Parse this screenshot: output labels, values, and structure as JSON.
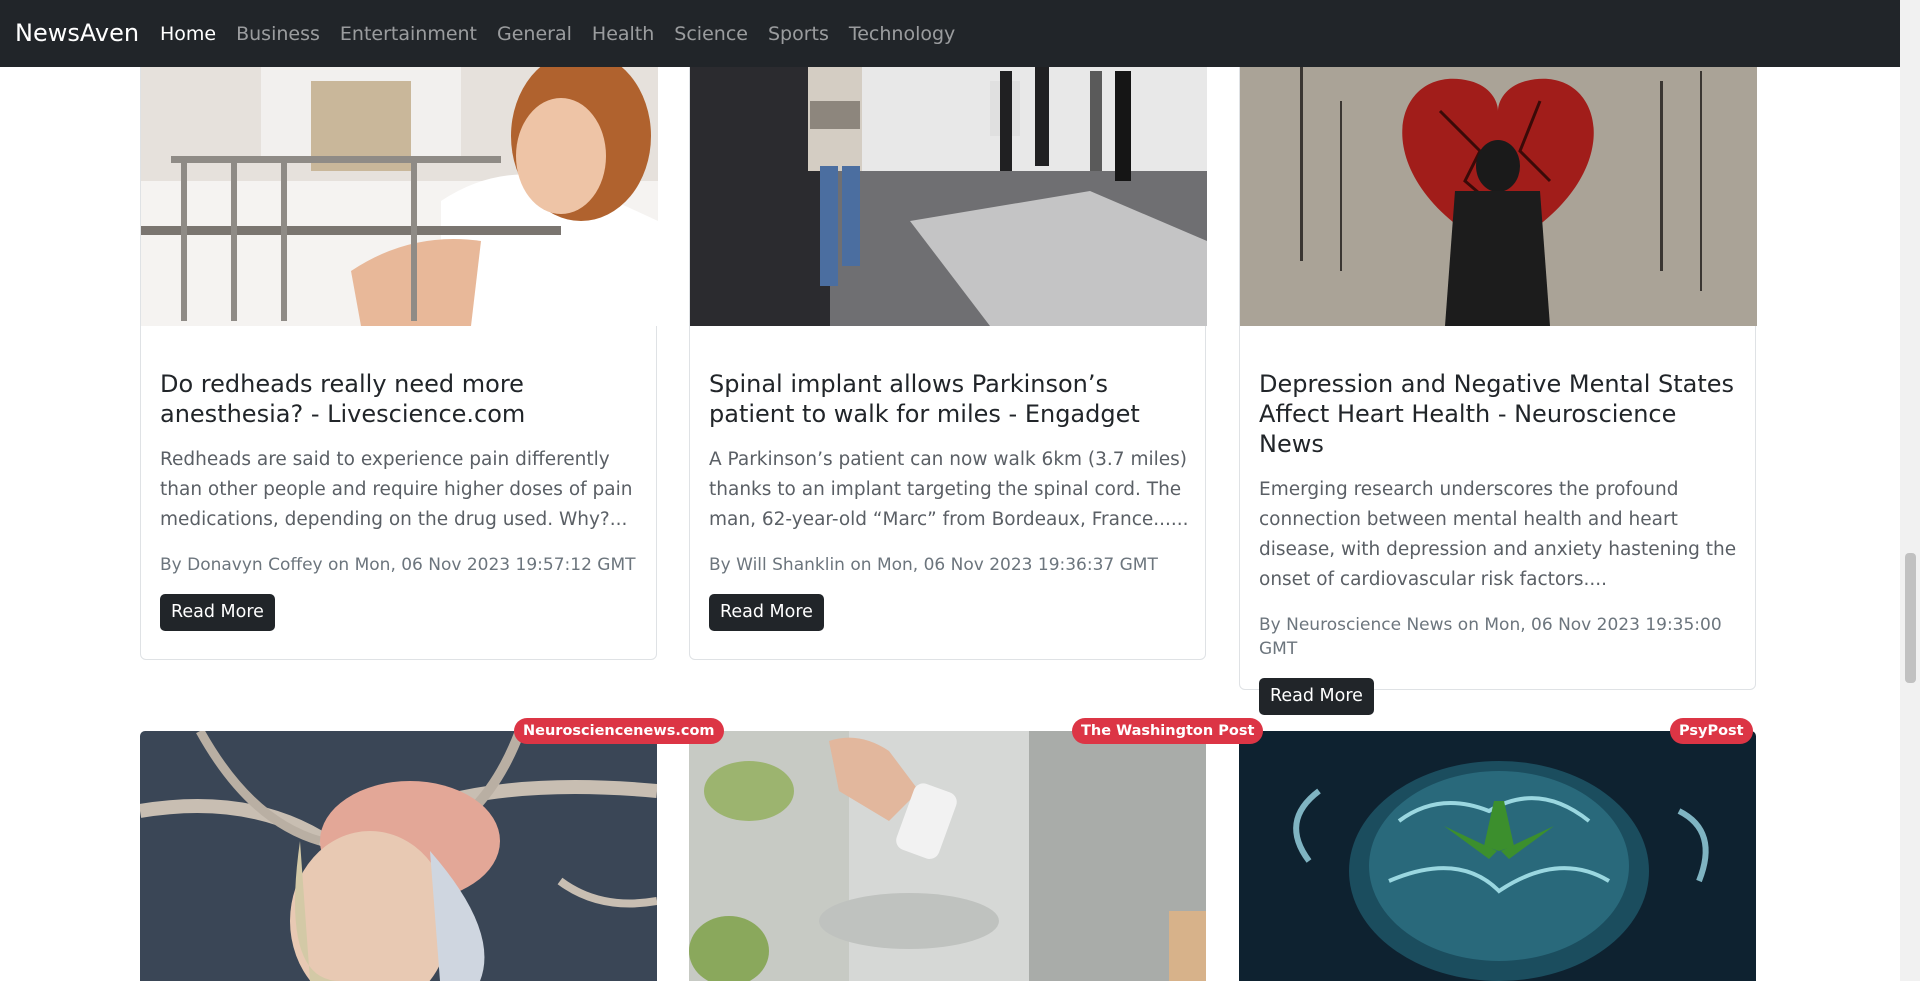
{
  "navbar": {
    "brand": "NewsAven",
    "links": [
      "Home",
      "Business",
      "Entertainment",
      "General",
      "Health",
      "Science",
      "Sports",
      "Technology"
    ]
  },
  "articles": [
    {
      "title": "Do redheads really need more anesthesia? - Livescience.com",
      "description": "Redheads are said to experience pain differently than other people and require higher doses of pain medications, depending on the drug used. Why?...",
      "meta": "By Donavyn Coffey on Mon, 06 Nov 2023 19:57:12 GMT",
      "button": "Read More"
    },
    {
      "title": "Spinal implant allows Parkinson’s patient to walk for miles - Engadget",
      "description": "A Parkinson’s patient can now walk 6km (3.7 miles) thanks to an implant targeting the spinal cord. The man, 62-year-old “Marc” from Bordeaux, France......",
      "meta": "By Will Shanklin on Mon, 06 Nov 2023 19:36:37 GMT",
      "button": "Read More"
    },
    {
      "title": "Depression and Negative Mental States Affect Heart Health - Neuroscience News",
      "description": "Emerging research underscores the profound connection between mental health and heart disease, with depression and anxiety hastening the onset of cardiovascular risk factors....",
      "meta": "By Neuroscience News on Mon, 06 Nov 2023 19:35:00 GMT",
      "button": "Read More"
    }
  ],
  "next_row_sources": [
    "Neurosciencenews.com",
    "The Washington Post",
    "PsyPost"
  ]
}
